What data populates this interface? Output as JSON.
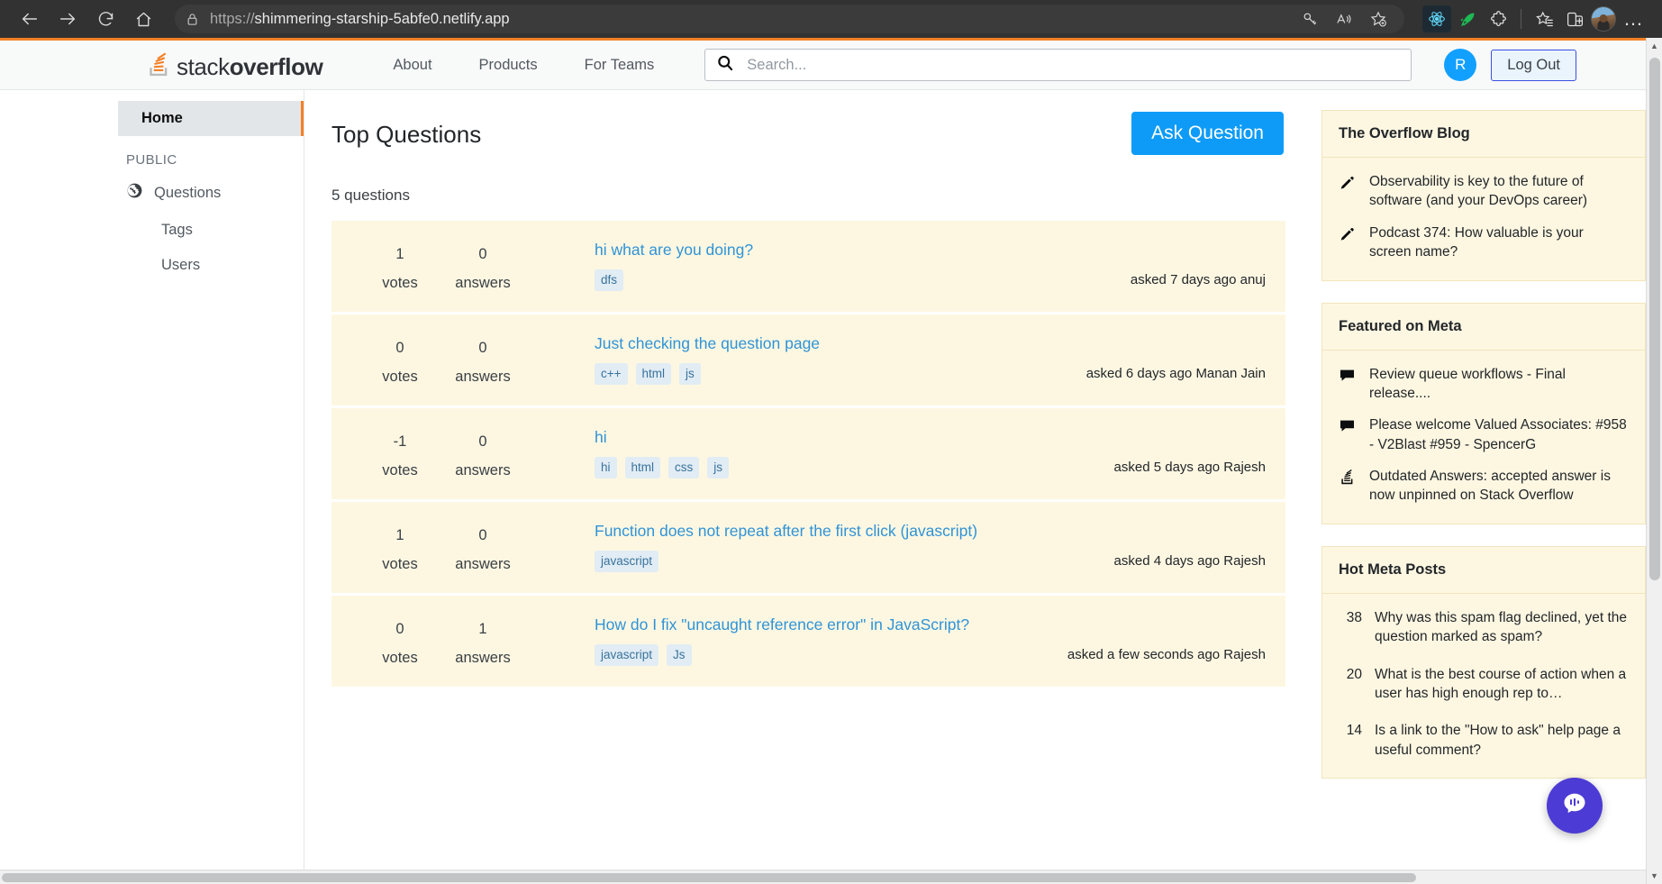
{
  "browser": {
    "back_icon": "arrow-left-icon",
    "forward_icon": "arrow-right-icon",
    "reload_icon": "reload-icon",
    "home_icon": "home-icon",
    "lock_icon": "lock-icon",
    "url_scheme": "https://",
    "url_host": "shimmering-starship-5abfe0.netlify.app",
    "toolbar_icons": [
      "key-icon",
      "read-aloud-icon",
      "add-favorite-icon",
      "react-devtools-extension-icon",
      "rocket-extension-icon",
      "extensions-puzzle-icon",
      "favorites-icon",
      "split-screen-icon"
    ],
    "profile_label": "profile-avatar",
    "more_label": "…"
  },
  "header": {
    "logo_text_light": "stack",
    "logo_text_bold": "overflow",
    "nav": [
      {
        "label": "About"
      },
      {
        "label": "Products"
      },
      {
        "label": "For Teams"
      }
    ],
    "search": {
      "icon": "search-icon",
      "placeholder": "Search...",
      "value": ""
    },
    "avatar_initial": "R",
    "logout_label": "Log Out"
  },
  "sidebar": {
    "home_label": "Home",
    "section_label": "PUBLIC",
    "items": [
      {
        "label": "Questions",
        "icon": "globe-icon"
      },
      {
        "label": "Tags",
        "icon": ""
      },
      {
        "label": "Users",
        "icon": ""
      }
    ]
  },
  "main": {
    "title": "Top Questions",
    "ask_button": "Ask Question",
    "count_text": "5 questions",
    "questions": [
      {
        "votes": "1",
        "votes_label": "votes",
        "answers": "0",
        "answers_label": "answers",
        "title": "hi what are you doing?",
        "tags": [
          "dfs"
        ],
        "asked": "asked 7 days ago anuj"
      },
      {
        "votes": "0",
        "votes_label": "votes",
        "answers": "0",
        "answers_label": "answers",
        "title": "Just checking the question page",
        "tags": [
          "c++",
          "html",
          "js"
        ],
        "asked": "asked 6 days ago Manan Jain"
      },
      {
        "votes": "-1",
        "votes_label": "votes",
        "answers": "0",
        "answers_label": "answers",
        "title": "hi",
        "tags": [
          "hi",
          "html",
          "css",
          "js"
        ],
        "asked": "asked 5 days ago Rajesh"
      },
      {
        "votes": "1",
        "votes_label": "votes",
        "answers": "0",
        "answers_label": "answers",
        "title": "Function does not repeat after the first click (javascript)",
        "tags": [
          "javascript"
        ],
        "asked": "asked 4 days ago Rajesh"
      },
      {
        "votes": "0",
        "votes_label": "votes",
        "answers": "1",
        "answers_label": "answers",
        "title": "How do I fix \"uncaught reference error\" in JavaScript?",
        "tags": [
          "javascript",
          "Js"
        ],
        "asked": "asked a few seconds ago Rajesh"
      }
    ]
  },
  "rail": {
    "blog": {
      "heading": "The Overflow Blog",
      "items": [
        {
          "icon": "pencil-icon",
          "text": "Observability is key to the future of software (and your DevOps career)"
        },
        {
          "icon": "pencil-icon",
          "text": "Podcast 374: How valuable is your screen name?"
        }
      ]
    },
    "meta": {
      "heading": "Featured on Meta",
      "items": [
        {
          "icon": "speech-bubble-icon",
          "text": "Review queue workflows - Final release...."
        },
        {
          "icon": "speech-bubble-icon",
          "text": "Please welcome Valued Associates: #958 - V2Blast #959 - SpencerG"
        },
        {
          "icon": "stackoverflow-icon",
          "text": "Outdated Answers: accepted answer is now unpinned on Stack Overflow"
        }
      ]
    },
    "hot": {
      "heading": "Hot Meta Posts",
      "items": [
        {
          "votes": "38",
          "text": "Why was this spam flag declined, yet the question marked as spam?"
        },
        {
          "votes": "20",
          "text": "What is the best course of action when a user has high enough rep to…"
        },
        {
          "votes": "14",
          "text": "Is a link to the \"How to ask\" help page a useful comment?"
        }
      ]
    }
  },
  "chat": {
    "icon": "chat-bubble-icon"
  },
  "colors": {
    "so_orange": "#f48024",
    "link_blue": "#3093d6",
    "ask_blue": "#0d9bf7",
    "row_cream": "#fdf7e2",
    "tag_bg": "#e1ecf4",
    "tag_fg": "#39739d",
    "chat_purple": "#4c3bd4"
  }
}
